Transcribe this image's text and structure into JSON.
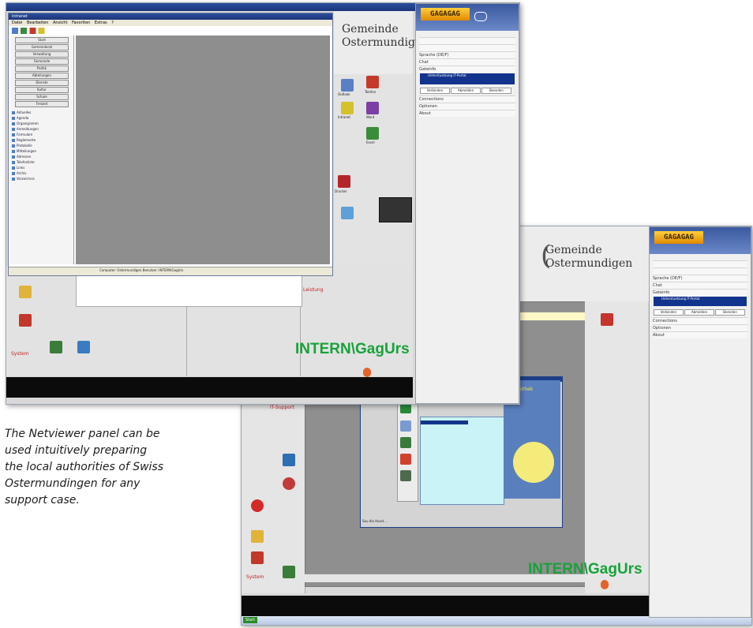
{
  "caption": {
    "line1": "The Netviewer panel can be",
    "line2": "used intuitively preparing",
    "line3": "the local authorities of Swiss",
    "line4": "Ostermundingen for any",
    "line5": "support case."
  },
  "back_screen": {
    "logo_line1": "Gemeinde",
    "logo_line2": "Ostermundigen",
    "user_label": "INTERN\\GagUrs",
    "section_leistung": "Leistung",
    "section_it": "IT-Support",
    "section_system": "System",
    "dialog_title": "Mediothek",
    "dialog_status": "Sou die Ausst...",
    "taskbar_start": "Start"
  },
  "front_screen": {
    "logo_line1": "Gemeinde",
    "logo_line2": "Ostermundigen",
    "user_label": "INTERN\\GagUrs",
    "section_leistung": "Leistung",
    "section_system": "System",
    "window_title": "Intranet",
    "status_text": "Computer: Ostermundigen  Benutzer: INTERN\\GagUrs",
    "menu_items": [
      "Datei",
      "Bearbeiten",
      "Ansicht",
      "Favoriten",
      "Extras",
      "?"
    ],
    "nav_buttons": [
      "Start",
      "Gemeinderat",
      "Verwaltung",
      "Gemeinde",
      "Politik",
      "Abteilungen",
      "Dienste",
      "Kultur",
      "Schule",
      "Freizeit"
    ],
    "tree_items": [
      "Aktuelles",
      "Agenda",
      "Organigramm",
      "Anmeldungen",
      "Formulare",
      "Reglemente",
      "Protokolle",
      "Mitteilungen",
      "Adressen",
      "Telefonliste",
      "Links",
      "Archiv",
      "Verzeichnis"
    ],
    "desktop_icons": [
      "Outlook",
      "Telefon",
      "Intranet",
      "Word",
      "Excel",
      "Drucker"
    ]
  },
  "netviewer_panel": {
    "logo_text": "GAGAGAG",
    "sections": [
      "Sprache (DE/F)",
      "Chat",
      "Gateinfo",
      "Connections",
      "Optionen",
      "About"
    ],
    "selected_session": "Unterstuetzung IT-Portal",
    "buttons": [
      "Verbinden",
      "Abmelden",
      "Beenden"
    ]
  }
}
